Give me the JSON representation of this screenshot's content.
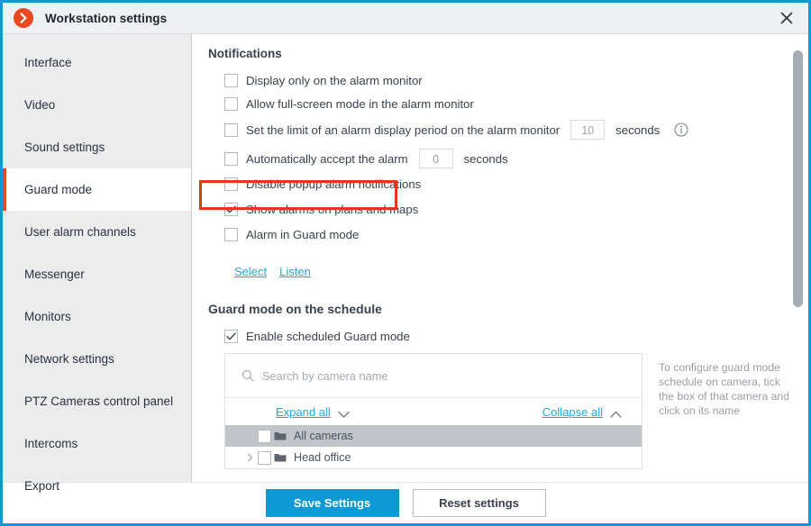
{
  "window": {
    "title": "Workstation settings",
    "app_icon": "orange-arrow-circle-icon",
    "close_label": "×",
    "accent_blue": "#0d99d6",
    "accent_red": "#e03a14",
    "brand_orange": "#e8491f"
  },
  "sidebar": {
    "items": [
      {
        "label": "Interface",
        "active": false
      },
      {
        "label": "Video",
        "active": false
      },
      {
        "label": "Sound settings",
        "active": false
      },
      {
        "label": "Guard mode",
        "active": true
      },
      {
        "label": "User alarm channels",
        "active": false
      },
      {
        "label": "Messenger",
        "active": false
      },
      {
        "label": "Monitors",
        "active": false
      },
      {
        "label": "Network settings",
        "active": false
      },
      {
        "label": "PTZ Cameras control panel",
        "active": false
      },
      {
        "label": "Intercoms",
        "active": false
      },
      {
        "label": "Export",
        "active": false
      }
    ]
  },
  "notifications": {
    "heading": "Notifications",
    "rows": [
      {
        "label": "Display only on the alarm monitor",
        "checked": false
      },
      {
        "label": "Allow full-screen mode in the alarm monitor",
        "checked": false
      },
      {
        "label": "Set the limit of an alarm display period on the alarm monitor",
        "checked": false,
        "value": "10",
        "unit": "seconds",
        "info": true
      },
      {
        "label": "Automatically accept the alarm",
        "checked": false,
        "value": "0",
        "unit": "seconds",
        "info": false
      },
      {
        "label": "Disable popup alarm notifications",
        "checked": false
      },
      {
        "label": "Show alarms on plans and maps",
        "checked": true,
        "highlighted": true
      },
      {
        "label": "Alarm in Guard mode",
        "checked": false
      }
    ],
    "links": [
      {
        "label": "Select"
      },
      {
        "label": "Listen"
      }
    ]
  },
  "schedule": {
    "heading": "Guard mode on the schedule",
    "enable": {
      "label": "Enable scheduled Guard mode",
      "checked": true
    },
    "search": {
      "placeholder": "Search by camera name",
      "value": ""
    },
    "expand_all": "Expand all",
    "collapse_all": "Collapse all",
    "tree": [
      {
        "label": "All cameras",
        "checked": false,
        "selected": true,
        "has_arrow": false,
        "indent": 0
      },
      {
        "label": "Head office",
        "checked": false,
        "selected": false,
        "has_arrow": true,
        "indent": 0
      }
    ],
    "hint": "To configure guard mode schedule on camera, tick the box of that camera and click on its name"
  },
  "footer": {
    "save_label": "Save Settings",
    "reset_label": "Reset settings"
  }
}
